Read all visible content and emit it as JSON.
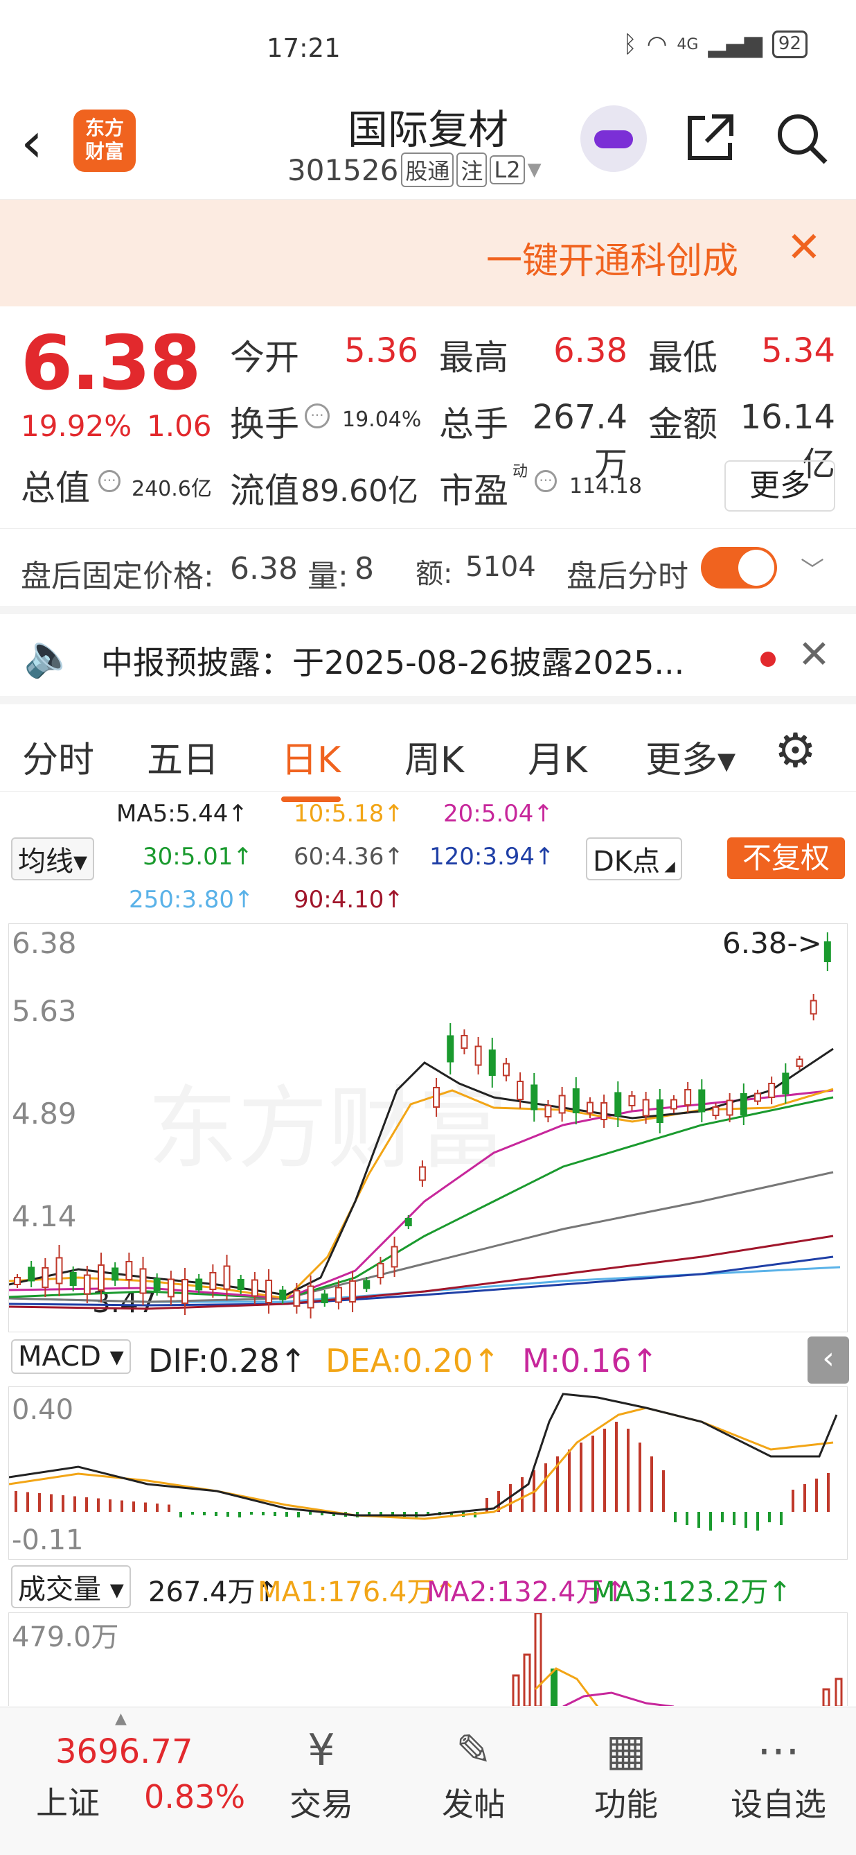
{
  "status": {
    "time": "17:21",
    "battery": "92",
    "signal": "4G"
  },
  "header": {
    "logo": "东方\n财富",
    "title": "国际复材",
    "code": "301526",
    "tags": [
      "股通",
      "注",
      "L2"
    ]
  },
  "banner": {
    "text": "一键开通科创成"
  },
  "quote": {
    "price": "6.38",
    "change_pct": "19.92%",
    "change": "1.06",
    "open_label": "今开",
    "open": "5.36",
    "high_label": "最高",
    "high": "6.38",
    "low_label": "最低",
    "low": "5.34",
    "turnover_label": "换手",
    "turnover": "19.04%",
    "volume_label": "总手",
    "volume": "267.4万",
    "amount_label": "金额",
    "amount": "16.14亿",
    "mktcap_label": "总值",
    "mktcap": "240.6亿",
    "float_label": "流值",
    "float": "89.60亿",
    "pe_label": "市盈",
    "pe_sup": "动",
    "pe": "114.18",
    "more": "更多"
  },
  "after_hours": {
    "label": "盘后固定价格:",
    "price": "6.38",
    "vol_label": "量:",
    "vol": "8",
    "amt_label": "额:",
    "amt": "5104",
    "switch_label": "盘后分时"
  },
  "notice": {
    "text": "中报预披露：于2025-08-26披露2025..."
  },
  "tabs": [
    "分时",
    "五日",
    "日K",
    "周K",
    "月K",
    "更多▾"
  ],
  "active_tab": 2,
  "ma": {
    "selector": "均线▾",
    "ma5": "MA5:5.44↑",
    "ma10": "10:5.18↑",
    "ma20": "20:5.04↑",
    "ma30": "30:5.01↑",
    "ma60": "60:4.36↑",
    "ma120": "120:3.94↑",
    "ma250": "250:3.80↑",
    "ma90": "90:4.10↑",
    "dk": "DK点",
    "adjust": "不复权"
  },
  "kchart": {
    "y_labels": [
      "6.38",
      "5.63",
      "4.89",
      "4.14"
    ],
    "last_label": "6.38->",
    "low_label": "3.47"
  },
  "macd": {
    "selector": "MACD ▾",
    "dif": "DIF:0.28↑",
    "dea": "DEA:0.20↑",
    "m": "M:0.16↑",
    "y_top": "0.40",
    "y_bottom": "-0.11"
  },
  "volume": {
    "selector": "成交量 ▾",
    "value": "267.4万↑",
    "ma1": "MA1:176.4万↑",
    "ma2": "MA2:132.4万↑",
    "ma3": "MA3:123.2万↑",
    "y_top": "479.0万"
  },
  "nav": {
    "index_value": "3696.77",
    "index_name": "上证",
    "index_pct": "0.83%",
    "items": [
      "交易",
      "发帖",
      "功能",
      "设自选"
    ]
  },
  "colors": {
    "accent": "#f0631f",
    "up": "#e2292d",
    "down": "#1a9a2e"
  }
}
